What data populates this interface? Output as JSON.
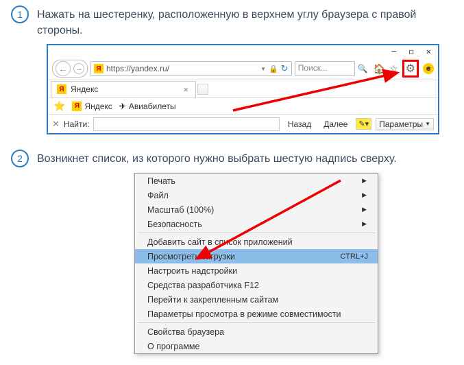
{
  "steps": [
    {
      "num": "1",
      "text": "Нажать на шестеренку, расположенную в верхнем углу браузера с правой стороны."
    },
    {
      "num": "2",
      "text": "Возникнет список, из которого нужно выбрать шестую надпись сверху."
    }
  ],
  "browser": {
    "win": {
      "min": "—",
      "max": "◻",
      "close": "✕"
    },
    "url": "https://yandex.ru/",
    "url_logo": "Я",
    "search_placeholder": "Поиск...",
    "tab": {
      "logo": "Я",
      "title": "Яндекс",
      "close": "×"
    },
    "bookmarks": {
      "b1": "Яндекс",
      "b2": "Авиабилеты"
    },
    "find": {
      "close": "✕",
      "label": "Найти:",
      "back": "Назад",
      "next": "Далее",
      "params": "Параметры"
    }
  },
  "menu": {
    "items": [
      {
        "label": "Печать",
        "sub": true
      },
      {
        "label": "Файл",
        "sub": true
      },
      {
        "label": "Масштаб (100%)",
        "sub": true
      },
      {
        "label": "Безопасность",
        "sub": true
      }
    ],
    "add_site": "Добавить сайт в список приложений",
    "downloads": {
      "label": "Просмотреть загрузки",
      "shortcut": "CTRL+J"
    },
    "addons": "Настроить надстройки",
    "devtools": "Средства разработчика F12",
    "pinned": "Перейти к закрепленным сайтам",
    "compat": "Параметры просмотра в режиме совместимости",
    "props": "Свойства браузера",
    "about": "О программе"
  }
}
